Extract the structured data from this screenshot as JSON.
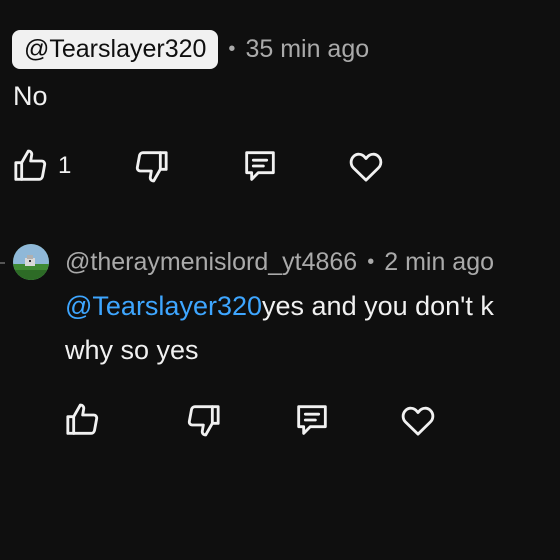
{
  "comment1": {
    "author": "@Tearslayer320",
    "separator": "•",
    "time": "35 min ago",
    "text": "No",
    "like_count": "1"
  },
  "comment2": {
    "author": "@theraymenislord_yt4866",
    "separator": "•",
    "time": "2 min ago",
    "mention": "@Tearslayer320",
    "text_line1": "yes and you don't k",
    "text_line2": "why so yes"
  },
  "icons": {
    "like": "thumbs-up-icon",
    "dislike": "thumbs-down-icon",
    "reply": "comment-icon",
    "heart": "heart-icon"
  },
  "colors": {
    "background": "#0f0f0f",
    "text": "#f1f1f1",
    "secondary_text": "#aaaaaa",
    "mention": "#3ea6ff",
    "chip_background": "#f1f1f1"
  }
}
